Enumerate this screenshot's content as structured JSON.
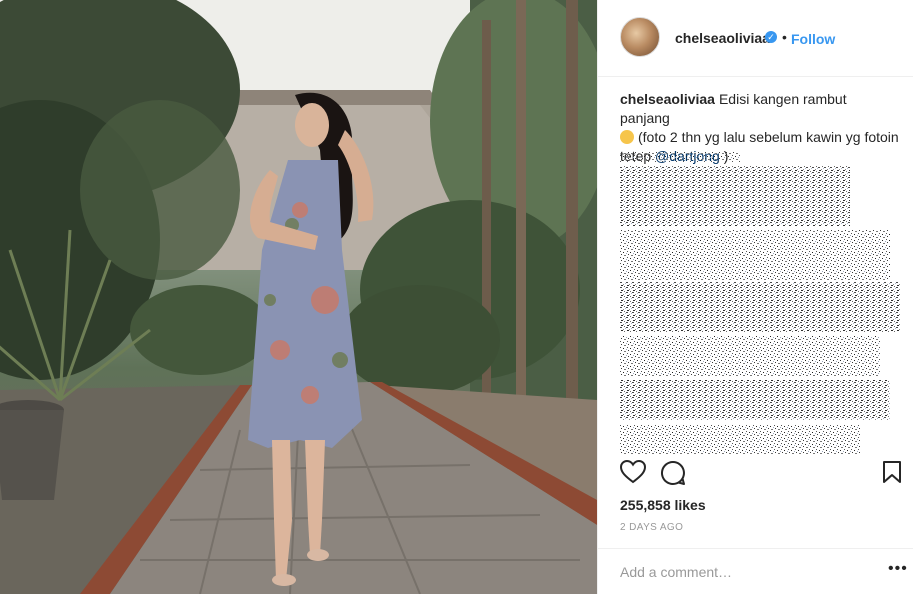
{
  "post": {
    "username": "chelseaoliviaa",
    "verified_glyph": "✓",
    "separator": "•",
    "follow_label": "Follow",
    "caption": {
      "username": "chelseaoliviaa",
      "text_part1": "Edisi kangen rambut panjang",
      "text_part2": "(foto 2 thn yg lalu sebelum kawin yg fotoin tetep",
      "mention": "@dartjong",
      "text_part3": ")"
    },
    "likes": "255,858 likes",
    "timestamp": "2 DAYS AGO",
    "comment_placeholder": "Add a comment…",
    "more_label": "•••"
  },
  "icons": {
    "like": "heart-icon",
    "comment": "speech-bubble-icon",
    "save": "bookmark-icon",
    "verified": "verified-badge-icon",
    "more": "ellipsis-icon"
  },
  "colors": {
    "link": "#3897f0",
    "mention": "#003569",
    "text": "#262626",
    "muted": "#999999",
    "border": "#efefef"
  }
}
